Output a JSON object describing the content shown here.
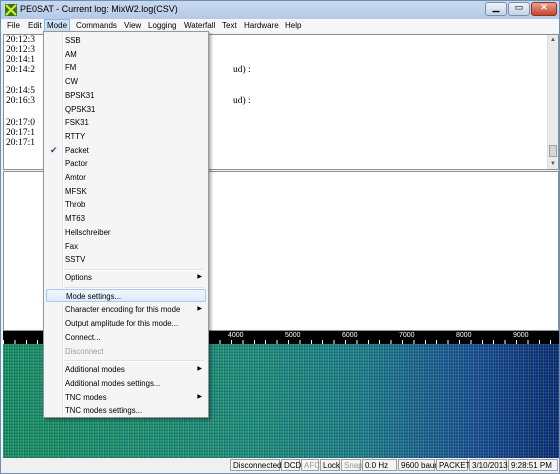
{
  "window": {
    "title": "PE0SAT - Current log: MixW2.log(CSV)"
  },
  "menubar": [
    "File",
    "Edit",
    "Mode",
    "Commands",
    "View",
    "Logging",
    "Waterfall",
    "Text",
    "Hardware",
    "Help"
  ],
  "rx": {
    "lines": [
      "20:12:3",
      "20:12:3",
      "20:14:1",
      "20:14:2",
      "",
      "20:14:5",
      "20:16:3",
      "",
      "20:17:0",
      "20:17:1",
      "20:17:1"
    ],
    "tails": [
      "ud) :",
      "ud) :"
    ]
  },
  "scale": {
    "labels": [
      "4000",
      "5000",
      "6000",
      "7000",
      "8000",
      "9000"
    ]
  },
  "mode_menu": {
    "items": [
      "SSB",
      "AM",
      "FM",
      "CW",
      "BPSK31",
      "QPSK31",
      "FSK31",
      "RTTY",
      "Packet",
      "Pactor",
      "Amtor",
      "MFSK",
      "Throb",
      "MT63",
      "Hellschreiber",
      "Fax",
      "SSTV"
    ],
    "checked": "Packet",
    "options": "Options",
    "group2": [
      "Mode settings...",
      "Character encoding for this mode",
      "Output amplitude for this mode...",
      "Connect...",
      "Disconnect"
    ],
    "group3": [
      "Additional modes",
      "Additional modes settings...",
      "TNC modes",
      "TNC modes settings..."
    ]
  },
  "status": {
    "connection": "Disconnected",
    "dcd": "DCD",
    "afc": "AFC",
    "lock": "Lock",
    "snap": "Snap",
    "freq": "0.0 Hz",
    "baud": "9600 baud",
    "mode": "PACKET",
    "date": "3/10/2013",
    "time": "9:28:51 PM"
  },
  "colors": {
    "waterfall_high": "#1a8c6a",
    "waterfall_low": "#0d2a7a",
    "menu_highlight": "#deebfa"
  }
}
